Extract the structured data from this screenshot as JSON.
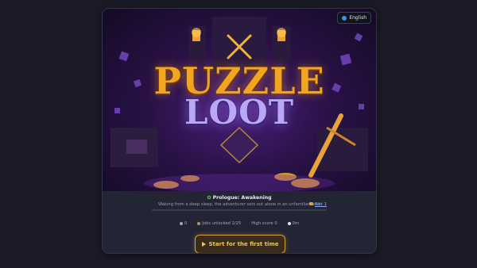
{
  "language_button": {
    "label": "English",
    "icon": "globe-icon"
  },
  "game": {
    "title_line1": "PUZZLE",
    "title_line2": "LOOT"
  },
  "chapter": {
    "label": "Prologue: Awakening",
    "description": "Waking from a deep sleep, the adventurer sets out alone in an unfamiliar land.",
    "progress": 0.0
  },
  "save_slot": {
    "label": "Slot 1"
  },
  "stats": {
    "gems": "0",
    "jobs": "Jobs unlocked 2/25",
    "high_score": "High score 0",
    "time": "0m"
  },
  "start_button": {
    "label": "Start for the first time"
  },
  "colors": {
    "accent": "#d8a23c",
    "title_gold": "#f2a51f",
    "title_purple": "#b9a8f6",
    "background": "#1b1b27"
  }
}
